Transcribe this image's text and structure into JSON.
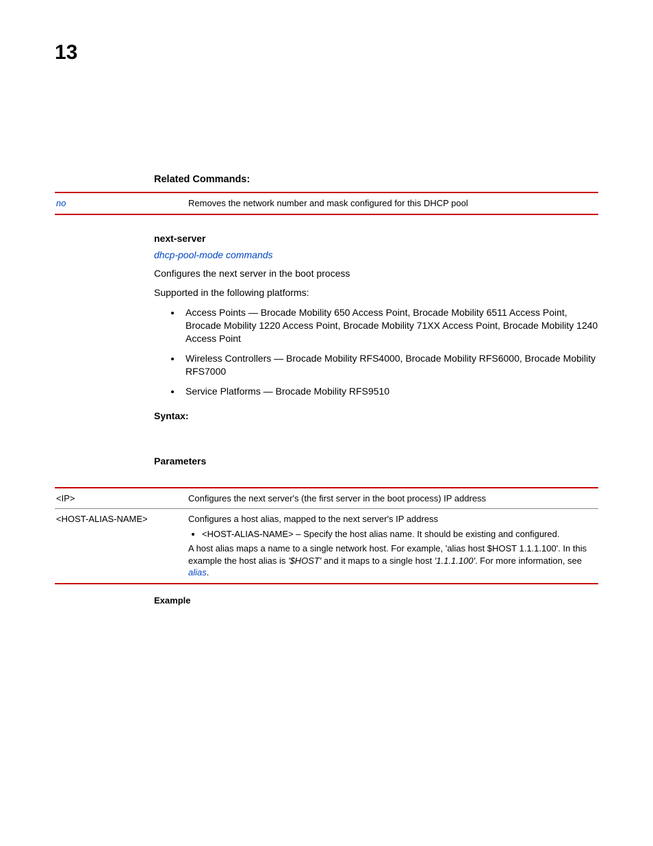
{
  "chapter": "13",
  "related_commands": {
    "heading": "Related Commands:",
    "rows": [
      {
        "term": "no",
        "desc": "Removes the network number and mask configured for this DHCP pool"
      }
    ]
  },
  "next_server": {
    "heading": "next-server",
    "breadcrumb": "dhcp-pool-mode commands",
    "intro": "Configures the next server in the boot process",
    "supported_label": "Supported in the following platforms:",
    "platforms": [
      "Access Points — Brocade Mobility 650 Access Point, Brocade Mobility 6511 Access Point, Brocade Mobility 1220 Access Point, Brocade Mobility 71XX Access Point, Brocade Mobility 1240 Access Point",
      "Wireless Controllers — Brocade Mobility RFS4000, Brocade Mobility RFS6000, Brocade Mobility RFS7000",
      "Service Platforms — Brocade Mobility RFS9510"
    ],
    "syntax_heading": "Syntax:",
    "parameters_heading": "Parameters",
    "param_rows": {
      "r0": {
        "term": "<IP>",
        "desc": "Configures the next server's (the first server in the boot process) IP address"
      },
      "r1": {
        "term": "<HOST-ALIAS-NAME>",
        "line1": "Configures a host alias, mapped to the next server's IP address",
        "bullet": "<HOST-ALIAS-NAME> – Specify the host alias name. It should be existing and configured.",
        "line2a": "A host alias maps a name to a single network host. For example, 'alias host $HOST 1.1.1.100'. In this example the host alias is ",
        "line2b": "'$HOST'",
        "line2c": " and it maps to a single host ",
        "line2d": "'1.1.1.100'",
        "line2e": ". For more information, see ",
        "link": "alias",
        "period": "."
      }
    },
    "example_heading": "Example"
  }
}
